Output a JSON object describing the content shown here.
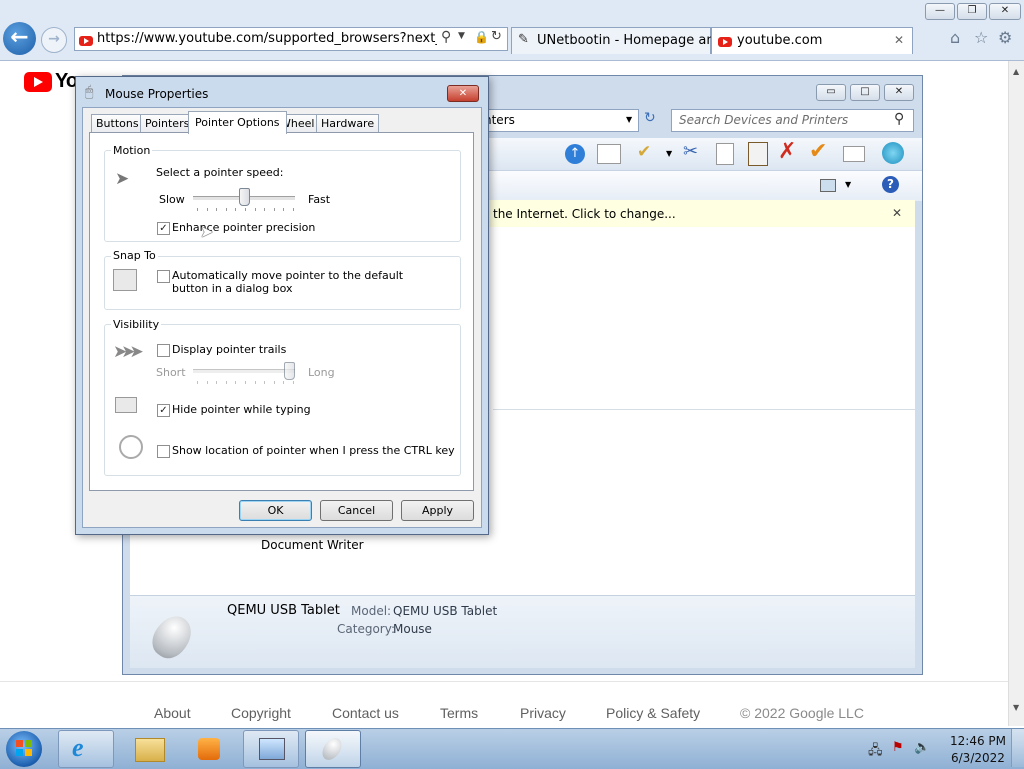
{
  "browser": {
    "address": "https://www.youtube.com/supported_browsers?next_url=https%",
    "tabs": [
      {
        "title": "UNetbootin - Homepage and ..."
      },
      {
        "title": "youtube.com"
      }
    ],
    "window_buttons": {
      "minimize": "—",
      "restore": "❐",
      "close": "✕"
    },
    "nav": {
      "back": "←",
      "forward": "→"
    },
    "address_icons": {
      "search": "search-icon",
      "dropdown": "chevron-down-icon",
      "lock": "lock-icon",
      "refresh": "refresh-icon"
    },
    "tab_close": "✕",
    "toolbar_icons": {
      "home": "⌂",
      "favorites": "☆",
      "tools": "⚙"
    }
  },
  "page": {
    "logo_partial": "YouTube",
    "footer": {
      "links": [
        "About",
        "Copyright",
        "Contact us",
        "Terms",
        "Privacy",
        "Policy & Safety"
      ],
      "copyright": "© 2022 Google LLC"
    }
  },
  "devices_window": {
    "search_placeholder": "Search Devices and Printers",
    "address_fragment": "nters",
    "info_bar": "the Internet. Click to change...",
    "info_close": "✕",
    "device_label": "Document Writer",
    "details": {
      "name": "QEMU USB Tablet",
      "model_label": "Model:",
      "model_value": "QEMU USB Tablet",
      "category_label": "Category:",
      "category_value": "Mouse"
    },
    "window_buttons": {
      "minimize": "▭",
      "maximize": "□",
      "close": "✕"
    }
  },
  "mouse_dialog": {
    "title": "Mouse Properties",
    "close": "✕",
    "tabs": [
      "Buttons",
      "Pointers",
      "Pointer Options",
      "Wheel",
      "Hardware"
    ],
    "active_tab": "Pointer Options",
    "motion": {
      "title": "Motion",
      "speed_label": "Select a pointer speed:",
      "slow": "Slow",
      "fast": "Fast",
      "speed_value": 0.5,
      "precision_label": "Enhance pointer precision",
      "precision_checked": "✓"
    },
    "snap_to": {
      "title": "Snap To",
      "label": "Automatically move pointer to the default button in a dialog box",
      "checked": ""
    },
    "visibility": {
      "title": "Visibility",
      "trails_label": "Display pointer trails",
      "trails_checked": "",
      "short": "Short",
      "long": "Long",
      "trails_value": 1.0,
      "hide_label": "Hide pointer while typing",
      "hide_checked": "✓",
      "ctrl_label": "Show location of pointer when I press the CTRL key",
      "ctrl_checked": ""
    },
    "buttons": {
      "ok": "OK",
      "cancel": "Cancel",
      "apply": "Apply"
    }
  },
  "taskbar": {
    "time": "12:46 PM",
    "date": "6/3/2022"
  }
}
